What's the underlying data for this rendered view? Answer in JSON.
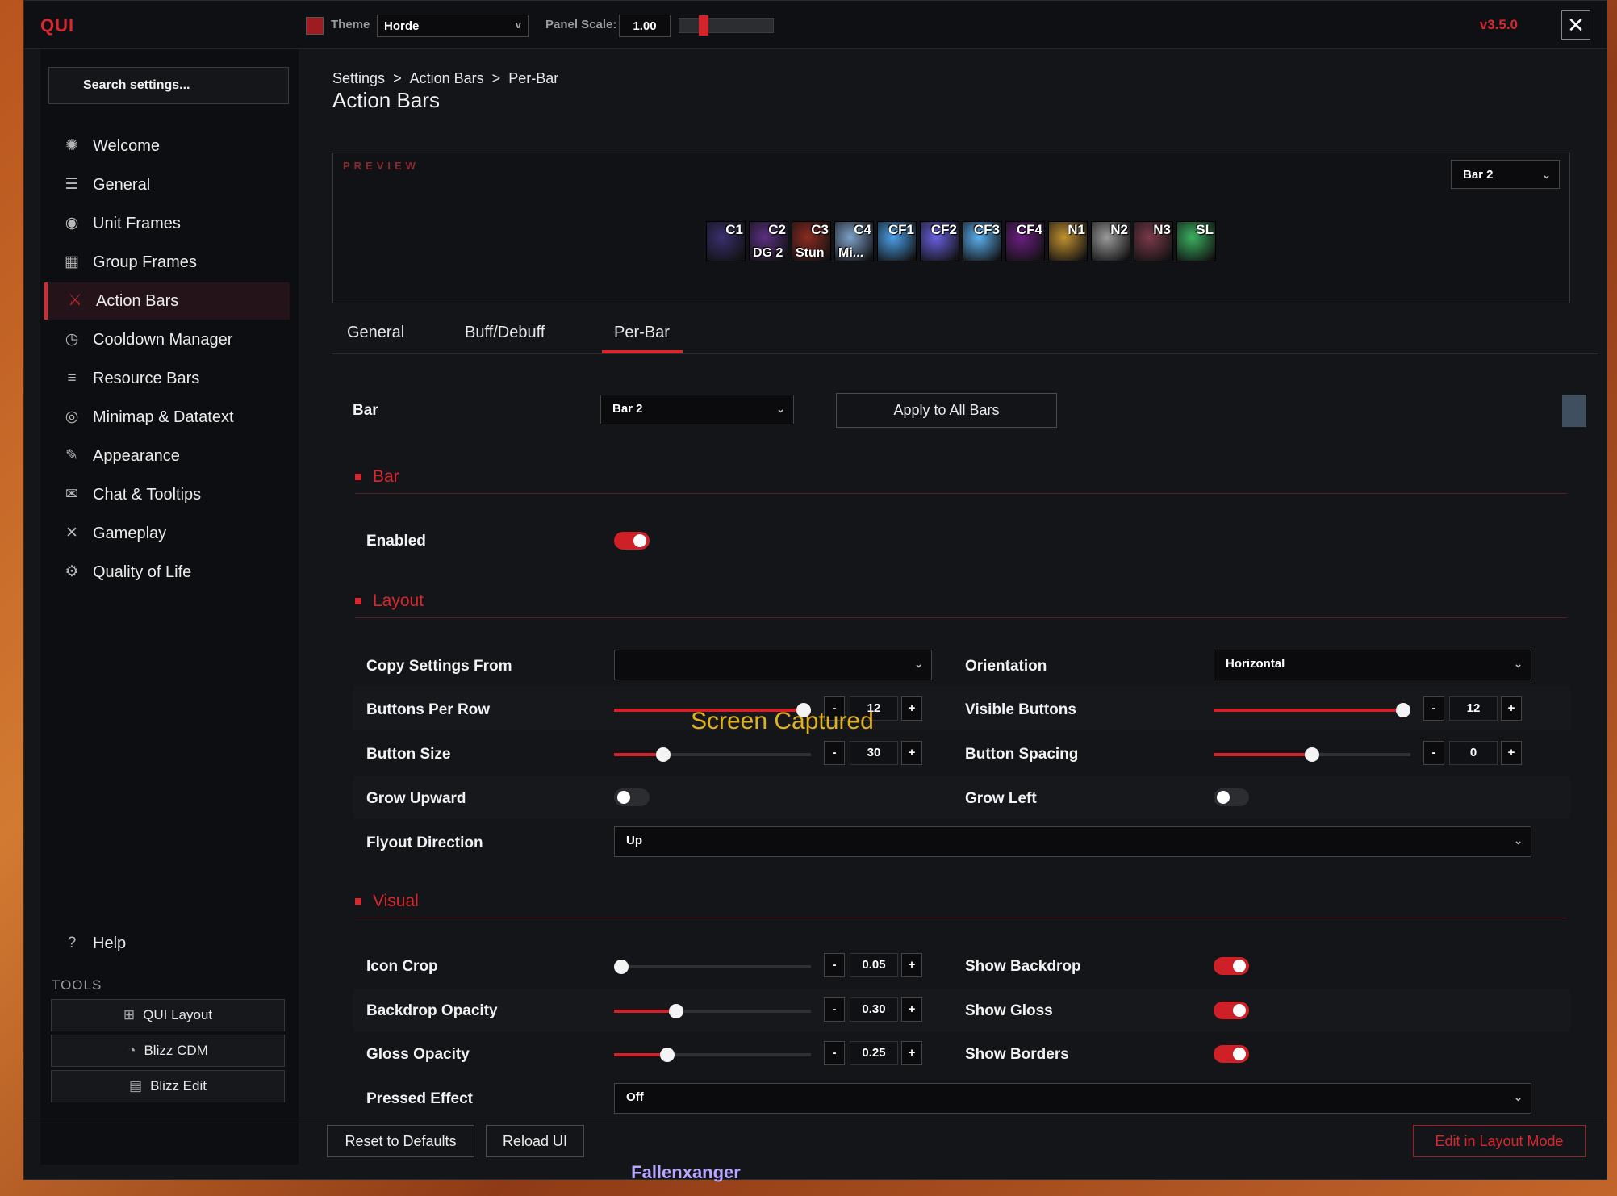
{
  "app": {
    "logo": "QUI",
    "version": "v3.5.0",
    "close": "✕"
  },
  "toolbar": {
    "theme_label": "Theme",
    "theme_value": "Horde",
    "panel_scale_label": "Panel Scale:",
    "panel_scale_value": "1.00",
    "panel_scale_fraction": 0.27
  },
  "sidebar": {
    "search_placeholder": "Search settings...",
    "items": [
      {
        "label": "Welcome",
        "icon": "sparkle-icon"
      },
      {
        "label": "General",
        "icon": "sliders-icon"
      },
      {
        "label": "Unit Frames",
        "icon": "portrait-icon"
      },
      {
        "label": "Group Frames",
        "icon": "group-icon"
      },
      {
        "label": "Action Bars",
        "icon": "action-bars-icon",
        "active": true
      },
      {
        "label": "Cooldown Manager",
        "icon": "clock-icon"
      },
      {
        "label": "Resource Bars",
        "icon": "bars-list-icon"
      },
      {
        "label": "Minimap & Datatext",
        "icon": "compass-icon"
      },
      {
        "label": "Appearance",
        "icon": "brush-icon"
      },
      {
        "label": "Chat & Tooltips",
        "icon": "chat-icon"
      },
      {
        "label": "Gameplay",
        "icon": "crossed-swords-icon"
      },
      {
        "label": "Quality of Life",
        "icon": "gear-icon"
      }
    ],
    "help": "Help",
    "tools_label": "TOOLS",
    "tools": [
      {
        "label": "QUI Layout",
        "icon": "layout-icon"
      },
      {
        "label": "Blizz CDM",
        "icon": "cdm-icon"
      },
      {
        "label": "Blizz Edit",
        "icon": "edit-icon"
      }
    ]
  },
  "main": {
    "breadcrumb": {
      "a": "Settings",
      "sep1": ">",
      "b": "Action Bars",
      "sep2": ">",
      "c": "Per-Bar"
    },
    "title": "Action Bars",
    "preview": {
      "label": "PREVIEW",
      "bar_select": "Bar 2",
      "icons": [
        {
          "hotkey": "C1",
          "macro": "",
          "color": "#3a2f6e"
        },
        {
          "hotkey": "C2",
          "macro": "DG 2",
          "color": "#5a2f80"
        },
        {
          "hotkey": "C3",
          "macro": "Stun",
          "color": "#8a2a20"
        },
        {
          "hotkey": "C4",
          "macro": "Mi...",
          "color": "#7da0c8"
        },
        {
          "hotkey": "CF1",
          "macro": "",
          "color": "#4aa0e8"
        },
        {
          "hotkey": "CF2",
          "macro": "",
          "color": "#6a60e0"
        },
        {
          "hotkey": "CF3",
          "macro": "",
          "color": "#5ab0f0"
        },
        {
          "hotkey": "CF4",
          "macro": "",
          "color": "#6a1e80"
        },
        {
          "hotkey": "N1",
          "macro": "",
          "color": "#c09030"
        },
        {
          "hotkey": "N2",
          "macro": "",
          "color": "#9a9a9a"
        },
        {
          "hotkey": "N3",
          "macro": "",
          "color": "#7a3a4a"
        },
        {
          "hotkey": "SL",
          "macro": "",
          "color": "#3ab060"
        }
      ]
    },
    "tabs": [
      "General",
      "Buff/Debuff",
      "Per-Bar"
    ],
    "active_tab": "Per-Bar",
    "bar_row": {
      "label": "Bar",
      "value": "Bar 2",
      "apply": "Apply to All Bars"
    },
    "sections": {
      "bar": "Bar",
      "layout": "Layout",
      "visual": "Visual"
    },
    "enabled": {
      "label": "Enabled",
      "on": true
    },
    "layout": {
      "copy_from": {
        "label": "Copy Settings From",
        "value": ""
      },
      "orientation": {
        "label": "Orientation",
        "value": "Horizontal"
      },
      "buttons_per_row": {
        "label": "Buttons Per Row",
        "value": "12",
        "fraction": 1.0
      },
      "visible_buttons": {
        "label": "Visible Buttons",
        "value": "12",
        "fraction": 1.0
      },
      "button_size": {
        "label": "Button Size",
        "value": "30",
        "fraction": 0.23
      },
      "button_spacing": {
        "label": "Button Spacing",
        "value": "0",
        "fraction": 0.5
      },
      "grow_upward": {
        "label": "Grow Upward",
        "on": false
      },
      "grow_left": {
        "label": "Grow Left",
        "on": false
      },
      "flyout": {
        "label": "Flyout Direction",
        "value": "Up"
      }
    },
    "visual": {
      "icon_crop": {
        "label": "Icon Crop",
        "value": "0.05",
        "fraction": 0.0
      },
      "backdrop_opacity": {
        "label": "Backdrop Opacity",
        "value": "0.30",
        "fraction": 0.3
      },
      "gloss_opacity": {
        "label": "Gloss Opacity",
        "value": "0.25",
        "fraction": 0.25
      },
      "show_backdrop": {
        "label": "Show Backdrop",
        "on": true
      },
      "show_gloss": {
        "label": "Show Gloss",
        "on": true
      },
      "show_borders": {
        "label": "Show Borders",
        "on": true
      },
      "pressed_effect": {
        "label": "Pressed Effect",
        "value": "Off"
      }
    },
    "stepper": {
      "minus": "-",
      "plus": "+"
    },
    "overlay": "Screen Captured"
  },
  "footer": {
    "reset": "Reset to Defaults",
    "reload": "Reload UI",
    "edit_layout": "Edit in Layout Mode"
  },
  "game_text": "Fallenxanger"
}
